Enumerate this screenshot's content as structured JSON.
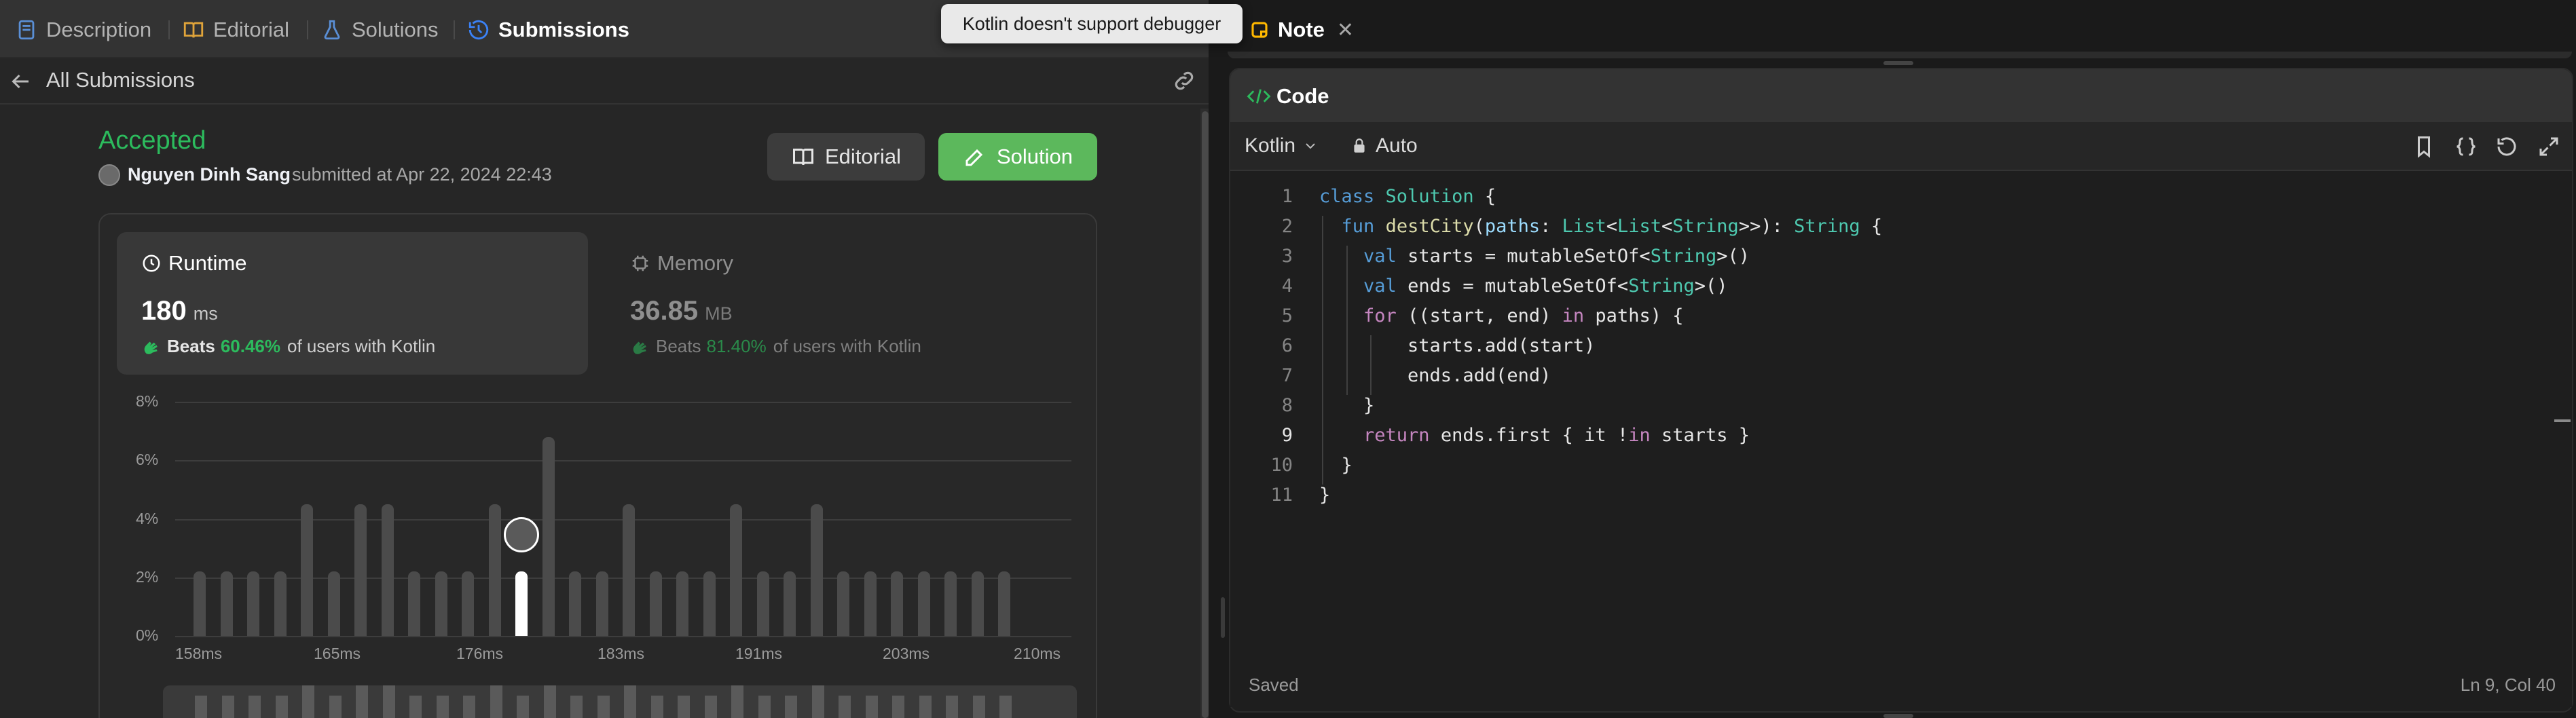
{
  "tabs": [
    {
      "label": "Description",
      "icon": "description-icon",
      "active": false
    },
    {
      "label": "Editorial",
      "icon": "book-icon",
      "active": false
    },
    {
      "label": "Solutions",
      "icon": "flask-icon",
      "active": false
    },
    {
      "label": "Submissions",
      "icon": "history-icon",
      "active": true
    }
  ],
  "tooltip": "Kotlin doesn't support debugger",
  "note_tab": {
    "label": "Note",
    "close": "✕"
  },
  "submission": {
    "back_label": "All Submissions",
    "status": "Accepted",
    "status_color": "#2cbb5d",
    "user": "Nguyen Dinh Sang",
    "submitted_text": "submitted at Apr 22, 2024 22:43",
    "editorial_btn": "Editorial",
    "solution_btn": "Solution"
  },
  "runtime": {
    "title": "Runtime",
    "value": "180",
    "unit": "ms",
    "beats_prefix": "Beats",
    "beats_pct": "60.46%",
    "beats_suffix": "of users with Kotlin"
  },
  "memory": {
    "title": "Memory",
    "value": "36.85",
    "unit": "MB",
    "beats_prefix": "Beats",
    "beats_pct": "81.40%",
    "beats_suffix": "of users with Kotlin"
  },
  "chart_data": {
    "type": "bar",
    "title": "",
    "xlabel": "",
    "ylabel": "",
    "ylim": [
      0,
      8
    ],
    "yticks": [
      "8%",
      "6%",
      "4%",
      "2%",
      "0%"
    ],
    "xticks": [
      "158ms",
      "165ms",
      "176ms",
      "183ms",
      "191ms",
      "203ms",
      "210ms"
    ],
    "values": [
      2.2,
      2.2,
      2.2,
      2.2,
      4.5,
      2.2,
      4.5,
      4.5,
      2.2,
      2.2,
      2.2,
      4.5,
      2.2,
      6.8,
      2.2,
      2.2,
      4.5,
      2.2,
      2.2,
      2.2,
      4.5,
      2.2,
      2.2,
      4.5,
      2.2,
      2.2,
      2.2,
      2.2,
      2.2,
      2.2,
      2.2
    ],
    "highlight_index": 12,
    "bar_color": "#4b4b4b",
    "highlight_color": "#ffffff"
  },
  "code_panel": {
    "title": "Code",
    "language": "Kotlin",
    "mode": "Auto",
    "status": "Saved",
    "cursor": "Ln 9, Col 40",
    "current_line": 9,
    "lines": [
      "class Solution {",
      "  fun destCity(paths: List<List<String>>): String {",
      "    val starts = mutableSetOf<String>()",
      "    val ends = mutableSetOf<String>()",
      "    for ((start, end) in paths) {",
      "        starts.add(start)",
      "        ends.add(end)",
      "    }",
      "    return ends.first { it !in starts }",
      "  }",
      "}"
    ],
    "line_numbers": [
      "1",
      "2",
      "3",
      "4",
      "5",
      "6",
      "7",
      "8",
      "9",
      "10",
      "11"
    ]
  },
  "colors": {
    "accent_green": "#5cb85c",
    "beats_green": "#2cbb5d",
    "active_tab_icon": "#3b82f6",
    "note_icon": "#ffb800"
  }
}
